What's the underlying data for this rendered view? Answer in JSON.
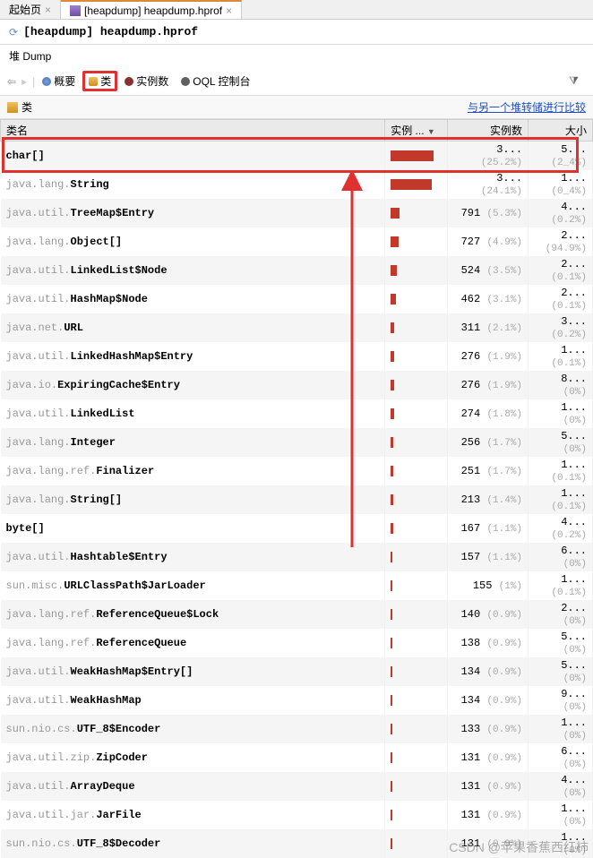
{
  "tabs": {
    "start_page": "起始页",
    "heapdump_tab": "[heapdump] heapdump.hprof"
  },
  "header": {
    "title": "[heapdump] heapdump.hprof"
  },
  "subtitle": "堆 Dump",
  "toolbar": {
    "summary": "概要",
    "classes": "类",
    "instances": "实例数",
    "oql": "OQL 控制台"
  },
  "section": {
    "label": "类",
    "compare_link": "与另一个堆转储进行比较"
  },
  "columns": {
    "classname": "类名",
    "instances_pct": "实例 ...",
    "instances": "实例数",
    "size": "大小"
  },
  "rows": [
    {
      "pkg": "",
      "cls": "char[]",
      "bar": 48,
      "inst": "3...",
      "inst_pct": "(25.2%)",
      "size": "5...",
      "size_pct": "(2_4%)",
      "hi": true
    },
    {
      "pkg": "java.lang.",
      "cls": "String",
      "bar": 46,
      "inst": "3...",
      "inst_pct": "(24.1%)",
      "size": "1...",
      "size_pct": "(0_4%)",
      "hi": true
    },
    {
      "pkg": "java.util.",
      "cls": "TreeMap$Entry",
      "bar": 10,
      "inst": "791",
      "inst_pct": "(5.3%)",
      "size": "4...",
      "size_pct": "(0.2%)"
    },
    {
      "pkg": "java.lang.",
      "cls": "Object[]",
      "bar": 9,
      "inst": "727",
      "inst_pct": "(4.9%)",
      "size": "2...",
      "size_pct": "(94.9%)"
    },
    {
      "pkg": "java.util.",
      "cls": "LinkedList$Node",
      "bar": 7,
      "inst": "524",
      "inst_pct": "(3.5%)",
      "size": "2...",
      "size_pct": "(0.1%)"
    },
    {
      "pkg": "java.util.",
      "cls": "HashMap$Node",
      "bar": 6,
      "inst": "462",
      "inst_pct": "(3.1%)",
      "size": "2...",
      "size_pct": "(0.1%)"
    },
    {
      "pkg": "java.net.",
      "cls": "URL",
      "bar": 4,
      "inst": "311",
      "inst_pct": "(2.1%)",
      "size": "3...",
      "size_pct": "(0.2%)"
    },
    {
      "pkg": "java.util.",
      "cls": "LinkedHashMap$Entry",
      "bar": 4,
      "inst": "276",
      "inst_pct": "(1.9%)",
      "size": "1...",
      "size_pct": "(0.1%)"
    },
    {
      "pkg": "java.io.",
      "cls": "ExpiringCache$Entry",
      "bar": 4,
      "inst": "276",
      "inst_pct": "(1.9%)",
      "size": "8...",
      "size_pct": "(0%)"
    },
    {
      "pkg": "java.util.",
      "cls": "LinkedList",
      "bar": 4,
      "inst": "274",
      "inst_pct": "(1.8%)",
      "size": "1...",
      "size_pct": "(0%)"
    },
    {
      "pkg": "java.lang.",
      "cls": "Integer",
      "bar": 3,
      "inst": "256",
      "inst_pct": "(1.7%)",
      "size": "5...",
      "size_pct": "(0%)"
    },
    {
      "pkg": "java.lang.ref.",
      "cls": "Finalizer",
      "bar": 3,
      "inst": "251",
      "inst_pct": "(1.7%)",
      "size": "1...",
      "size_pct": "(0.1%)"
    },
    {
      "pkg": "java.lang.",
      "cls": "String[]",
      "bar": 3,
      "inst": "213",
      "inst_pct": "(1.4%)",
      "size": "1...",
      "size_pct": "(0.1%)"
    },
    {
      "pkg": "",
      "cls": "byte[]",
      "bar": 3,
      "inst": "167",
      "inst_pct": "(1.1%)",
      "size": "4...",
      "size_pct": "(0.2%)"
    },
    {
      "pkg": "java.util.",
      "cls": "Hashtable$Entry",
      "bar": 2,
      "inst": "157",
      "inst_pct": "(1.1%)",
      "size": "6...",
      "size_pct": "(0%)"
    },
    {
      "pkg": "sun.misc.",
      "cls": "URLClassPath$JarLoader",
      "bar": 2,
      "inst": "155",
      "inst_pct": "(1%)",
      "size": "1...",
      "size_pct": "(0.1%)"
    },
    {
      "pkg": "java.lang.ref.",
      "cls": "ReferenceQueue$Lock",
      "bar": 2,
      "inst": "140",
      "inst_pct": "(0.9%)",
      "size": "2...",
      "size_pct": "(0%)"
    },
    {
      "pkg": "java.lang.ref.",
      "cls": "ReferenceQueue",
      "bar": 2,
      "inst": "138",
      "inst_pct": "(0.9%)",
      "size": "5...",
      "size_pct": "(0%)"
    },
    {
      "pkg": "java.util.",
      "cls": "WeakHashMap$Entry[]",
      "bar": 2,
      "inst": "134",
      "inst_pct": "(0.9%)",
      "size": "5...",
      "size_pct": "(0%)"
    },
    {
      "pkg": "java.util.",
      "cls": "WeakHashMap",
      "bar": 2,
      "inst": "134",
      "inst_pct": "(0.9%)",
      "size": "9...",
      "size_pct": "(0%)"
    },
    {
      "pkg": "sun.nio.cs.",
      "cls": "UTF_8$Encoder",
      "bar": 2,
      "inst": "133",
      "inst_pct": "(0.9%)",
      "size": "1...",
      "size_pct": "(0%)"
    },
    {
      "pkg": "java.util.zip.",
      "cls": "ZipCoder",
      "bar": 2,
      "inst": "131",
      "inst_pct": "(0.9%)",
      "size": "6...",
      "size_pct": "(0%)"
    },
    {
      "pkg": "java.util.",
      "cls": "ArrayDeque",
      "bar": 2,
      "inst": "131",
      "inst_pct": "(0.9%)",
      "size": "4...",
      "size_pct": "(0%)"
    },
    {
      "pkg": "java.util.jar.",
      "cls": "JarFile",
      "bar": 2,
      "inst": "131",
      "inst_pct": "(0.9%)",
      "size": "1...",
      "size_pct": "(0%)"
    },
    {
      "pkg": "sun.nio.cs.",
      "cls": "UTF_8$Decoder",
      "bar": 2,
      "inst": "131",
      "inst_pct": "(0.9%)",
      "size": "1...",
      "size_pct": "(0%)"
    }
  ],
  "watermark": "CSDN @苹果香蕉西红柿"
}
